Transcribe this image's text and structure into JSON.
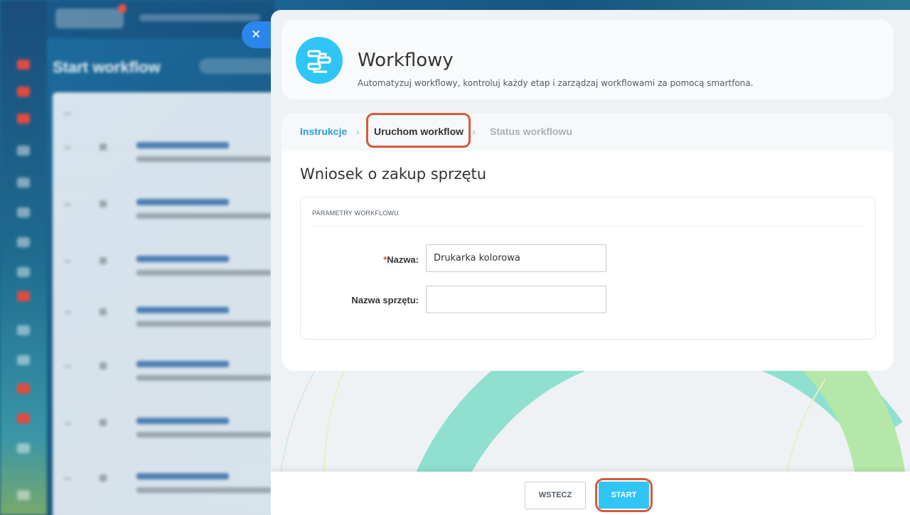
{
  "background": {
    "page_title": "Start workflow"
  },
  "panel": {
    "close_icon": "close-icon",
    "header": {
      "icon": "workflow-icon",
      "title": "Workflowy",
      "subtitle": "Automatyzuj workflowy, kontroluj każdy etap i zarządzaj workflowami za pomocą smartfona."
    },
    "steps": [
      {
        "label": "Instrukcje",
        "state": "link"
      },
      {
        "label": "Uruchom workflow",
        "state": "active"
      },
      {
        "label": "Status workflowu",
        "state": "inactive"
      }
    ],
    "step_separator_icon": "chevron-right-icon",
    "form": {
      "title": "Wniosek o zakup sprzętu",
      "section_title": "PARAMETRY WORKFLOWU",
      "fields": [
        {
          "required_mark": "*",
          "label": "Nazwa:",
          "value": "Drukarka kolorowa"
        },
        {
          "required_mark": "",
          "label": "Nazwa sprzętu:",
          "value": ""
        }
      ]
    },
    "footer": {
      "back_label": "WSTECZ",
      "start_label": "START"
    }
  },
  "colors": {
    "accent": "#2fc6f6",
    "link": "#2a9fd6",
    "highlight": "#d9593a",
    "close_button": "#2a86ea"
  }
}
